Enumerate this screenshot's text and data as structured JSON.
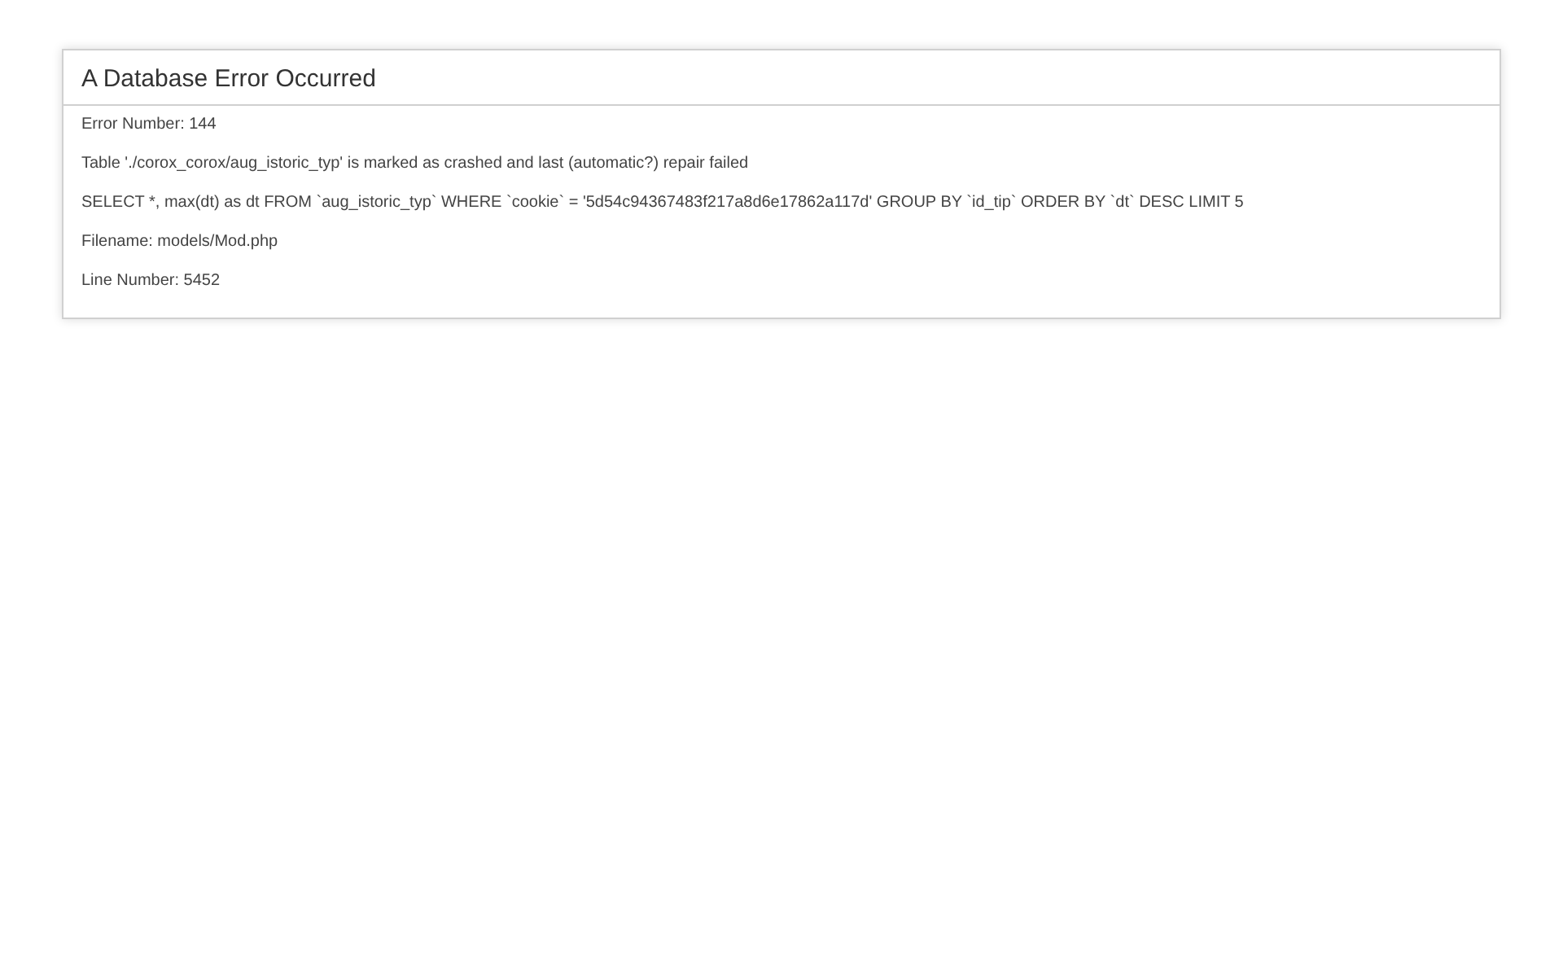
{
  "panel": {
    "title": "A Database Error Occurred",
    "lines": [
      "Error Number: 144",
      "Table './corox_corox/aug_istoric_typ' is marked as crashed and last (automatic?) repair failed",
      "SELECT *, max(dt) as dt FROM `aug_istoric_typ` WHERE `cookie` = '5d54c94367483f217a8d6e17862a117d' GROUP BY `id_tip` ORDER BY `dt` DESC LIMIT 5",
      "Filename: models/Mod.php",
      "Line Number: 5452"
    ]
  }
}
